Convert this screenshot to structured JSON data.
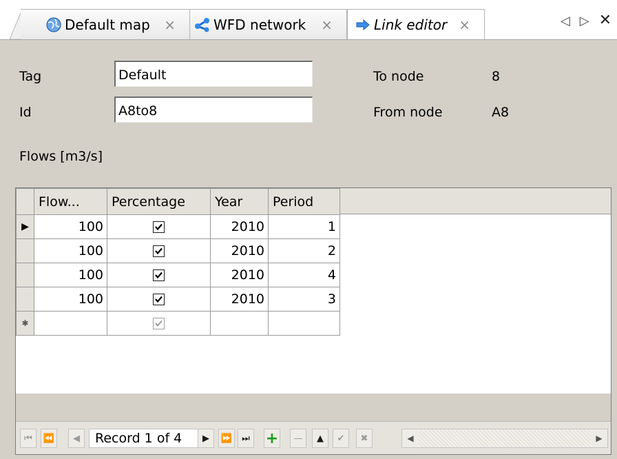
{
  "tabs": [
    {
      "label": "Default map",
      "close": "×",
      "icon": "globe-icon"
    },
    {
      "label": "WFD network",
      "close": "×",
      "icon": "network-icon"
    },
    {
      "label": "Link editor",
      "close": "×",
      "icon": "arrow-right-icon"
    }
  ],
  "tab_nav": {
    "prev": "◁",
    "next": "▷",
    "close": "✕"
  },
  "form": {
    "tag_label": "Tag",
    "tag_value": "Default",
    "id_label": "Id",
    "id_value": "A8to8",
    "to_node_label": "To node",
    "to_node_value": "8",
    "from_node_label": "From node",
    "from_node_value": "A8",
    "flows_label": "Flows [m3/s]"
  },
  "grid": {
    "columns": [
      "Flow...",
      "Percentage",
      "Year",
      "Period"
    ],
    "rows": [
      {
        "flow": "100",
        "percentage": true,
        "year": "2010",
        "period": "1"
      },
      {
        "flow": "100",
        "percentage": true,
        "year": "2010",
        "period": "2"
      },
      {
        "flow": "100",
        "percentage": true,
        "year": "2010",
        "period": "4"
      },
      {
        "flow": "100",
        "percentage": true,
        "year": "2010",
        "period": "3"
      }
    ],
    "current_row_marker": "▶",
    "new_row_marker": "✱"
  },
  "navigator": {
    "record_text": "Record 1 of 4"
  },
  "colors": {
    "panel_bg": "#d4d0c8",
    "add_green": "#1a9c1a"
  }
}
